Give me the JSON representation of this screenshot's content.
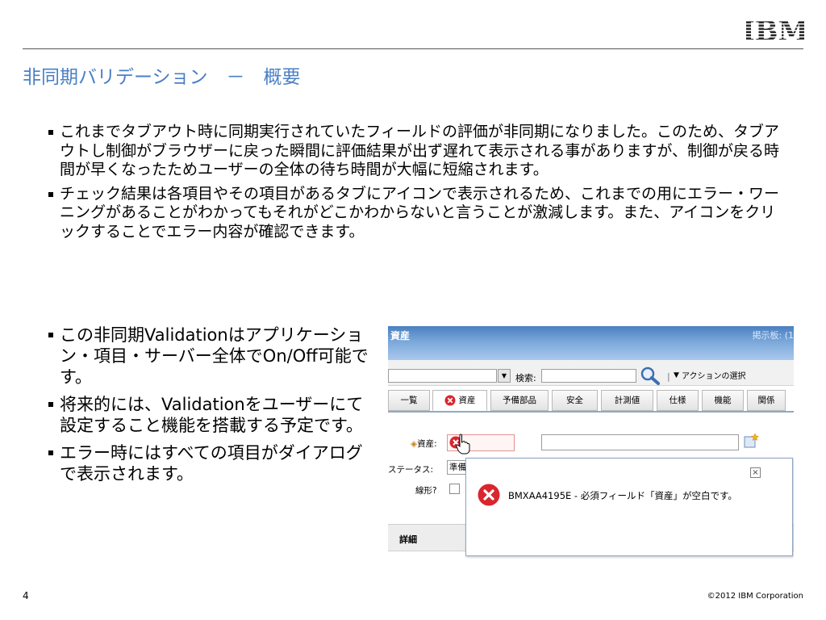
{
  "header": {
    "title": "非同期バリデーション　－　概要",
    "logo_text": "IBM"
  },
  "top_bullets": [
    "これまでタブアウト時に同期実行されていたフィールドの評価が非同期になりました。このため、タブアウトし制御がブラウザーに戻った瞬間に評価結果が出ず遅れて表示される事がありますが、制御が戻る時間が早くなったためユーザーの全体の待ち時間が大幅に短縮されます。",
    "チェック結果は各項目やその項目があるタブにアイコンで表示されるため、これまでの用にエラー・ワーニングがあることがわかってもそれがどこかわからないと言うことが激減します。また、アイコンをクリックすることでエラー内容が確認できます。"
  ],
  "left_bullets": [
    "この非同期Validationはアプリケーション・項目・サーバー全体でOn/Off可能です。",
    "将来的には、Validationをユーザーにて設定すること機能を搭載する予定です。",
    "エラー時にはすべての項目がダイアログで表示されます。"
  ],
  "screenshot": {
    "app_title": "資産",
    "board_label": "掲示板: (1",
    "search_label": "検索:",
    "action_select": "アクションの選択",
    "tabs": [
      "一覧",
      "資産",
      "予備部品",
      "安全",
      "計測値",
      "仕様",
      "機能",
      "関係"
    ],
    "fields": {
      "asset_label": "資産:",
      "status_label": "ステータス:",
      "status_value": "準備",
      "linear_label": "線形?"
    },
    "details_label": "詳細",
    "popup": {
      "close": "×",
      "message": "BMXAA4195E - 必須フィールド「資産」が空白です。"
    },
    "colors": {
      "header": "#6f9ed6",
      "error": "#d9262e"
    }
  },
  "footer": {
    "page_number": "4",
    "copyright": "©2012 IBM Corporation"
  }
}
